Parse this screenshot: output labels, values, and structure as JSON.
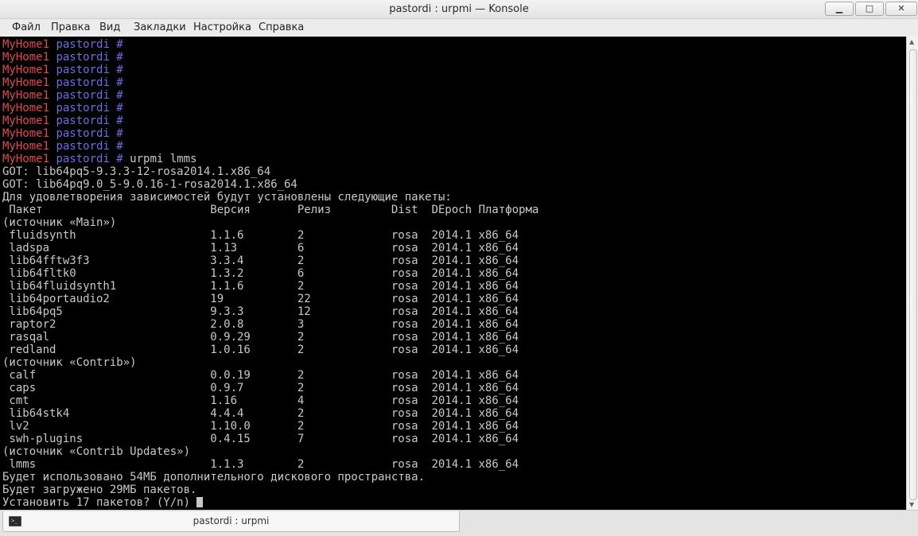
{
  "window": {
    "title": "pastordi : urpmi — Konsole",
    "minimize_icon": "minimize-icon",
    "maximize_icon": "maximize-icon",
    "close_icon": "close-icon"
  },
  "menu": [
    "Файл",
    "Правка",
    "Вид",
    "Закладки",
    "Настройка",
    "Справка"
  ],
  "terminal": {
    "colors": {
      "host": "#e0484c",
      "user": "#6e6ee0",
      "text": "#c8c8c8",
      "background": "#000000"
    },
    "prompt": {
      "host": "MyHome1",
      "user": "pastordi",
      "symbol": "#"
    },
    "lines": [
      {
        "type": "prompt",
        "cmd": ""
      },
      {
        "type": "prompt",
        "cmd": ""
      },
      {
        "type": "prompt",
        "cmd": ""
      },
      {
        "type": "prompt",
        "cmd": ""
      },
      {
        "type": "prompt",
        "cmd": ""
      },
      {
        "type": "prompt",
        "cmd": ""
      },
      {
        "type": "prompt",
        "cmd": ""
      },
      {
        "type": "prompt",
        "cmd": ""
      },
      {
        "type": "prompt",
        "cmd": ""
      },
      {
        "type": "prompt",
        "cmd": "urpmi lmms"
      },
      {
        "type": "text",
        "text": "GOT: lib64pq5-9.3.3-12-rosa2014.1.x86_64"
      },
      {
        "type": "text",
        "text": "GOT: lib64pq9.0_5-9.0.16-1-rosa2014.1.x86_64"
      },
      {
        "type": "text",
        "text": "Для удовлетворения зависимостей будут установлены следующие пакеты:"
      },
      {
        "type": "text",
        "text": " Пакет                         Версия       Релиз         Dist  DEpoch Платформа"
      },
      {
        "type": "text",
        "text": "(источник «Main»)"
      },
      {
        "type": "text",
        "text": " fluidsynth                    1.1.6        2             rosa  2014.1 x86_64"
      },
      {
        "type": "text",
        "text": " ladspa                        1.13         6             rosa  2014.1 x86_64"
      },
      {
        "type": "text",
        "text": " lib64fftw3f3                  3.3.4        2             rosa  2014.1 x86_64"
      },
      {
        "type": "text",
        "text": " lib64fltk0                    1.3.2        6             rosa  2014.1 x86_64"
      },
      {
        "type": "text",
        "text": " lib64fluidsynth1              1.1.6        2             rosa  2014.1 x86_64"
      },
      {
        "type": "text",
        "text": " lib64portaudio2               19           22            rosa  2014.1 x86_64"
      },
      {
        "type": "text",
        "text": " lib64pq5                      9.3.3        12            rosa  2014.1 x86_64"
      },
      {
        "type": "text",
        "text": " raptor2                       2.0.8        3             rosa  2014.1 x86_64"
      },
      {
        "type": "text",
        "text": " rasqal                        0.9.29       2             rosa  2014.1 x86_64"
      },
      {
        "type": "text",
        "text": " redland                       1.0.16       2             rosa  2014.1 x86_64"
      },
      {
        "type": "text",
        "text": "(источник «Contrib»)"
      },
      {
        "type": "text",
        "text": " calf                          0.0.19       2             rosa  2014.1 x86_64"
      },
      {
        "type": "text",
        "text": " caps                          0.9.7        2             rosa  2014.1 x86_64"
      },
      {
        "type": "text",
        "text": " cmt                           1.16         4             rosa  2014.1 x86_64"
      },
      {
        "type": "text",
        "text": " lib64stk4                     4.4.4        2             rosa  2014.1 x86_64"
      },
      {
        "type": "text",
        "text": " lv2                           1.10.0       2             rosa  2014.1 x86_64"
      },
      {
        "type": "text",
        "text": " swh-plugins                   0.4.15       7             rosa  2014.1 x86_64"
      },
      {
        "type": "text",
        "text": "(источник «Contrib Updates»)"
      },
      {
        "type": "text",
        "text": " lmms                          1.1.3        2             rosa  2014.1 x86_64"
      },
      {
        "type": "text",
        "text": "Будет использовано 54МБ дополнительного дискового пространства."
      },
      {
        "type": "text",
        "text": "Будет загружено 29МБ пакетов."
      },
      {
        "type": "text",
        "text": "Установить 17 пакетов? (Y/n) ",
        "cursor": true
      }
    ]
  },
  "scrollbar": {
    "up_icon": "scroll-up-arrow-icon",
    "down_icon": "scroll-down-arrow-icon"
  },
  "tab": {
    "label": "pastordi : urpmi",
    "icon": "terminal-icon"
  }
}
